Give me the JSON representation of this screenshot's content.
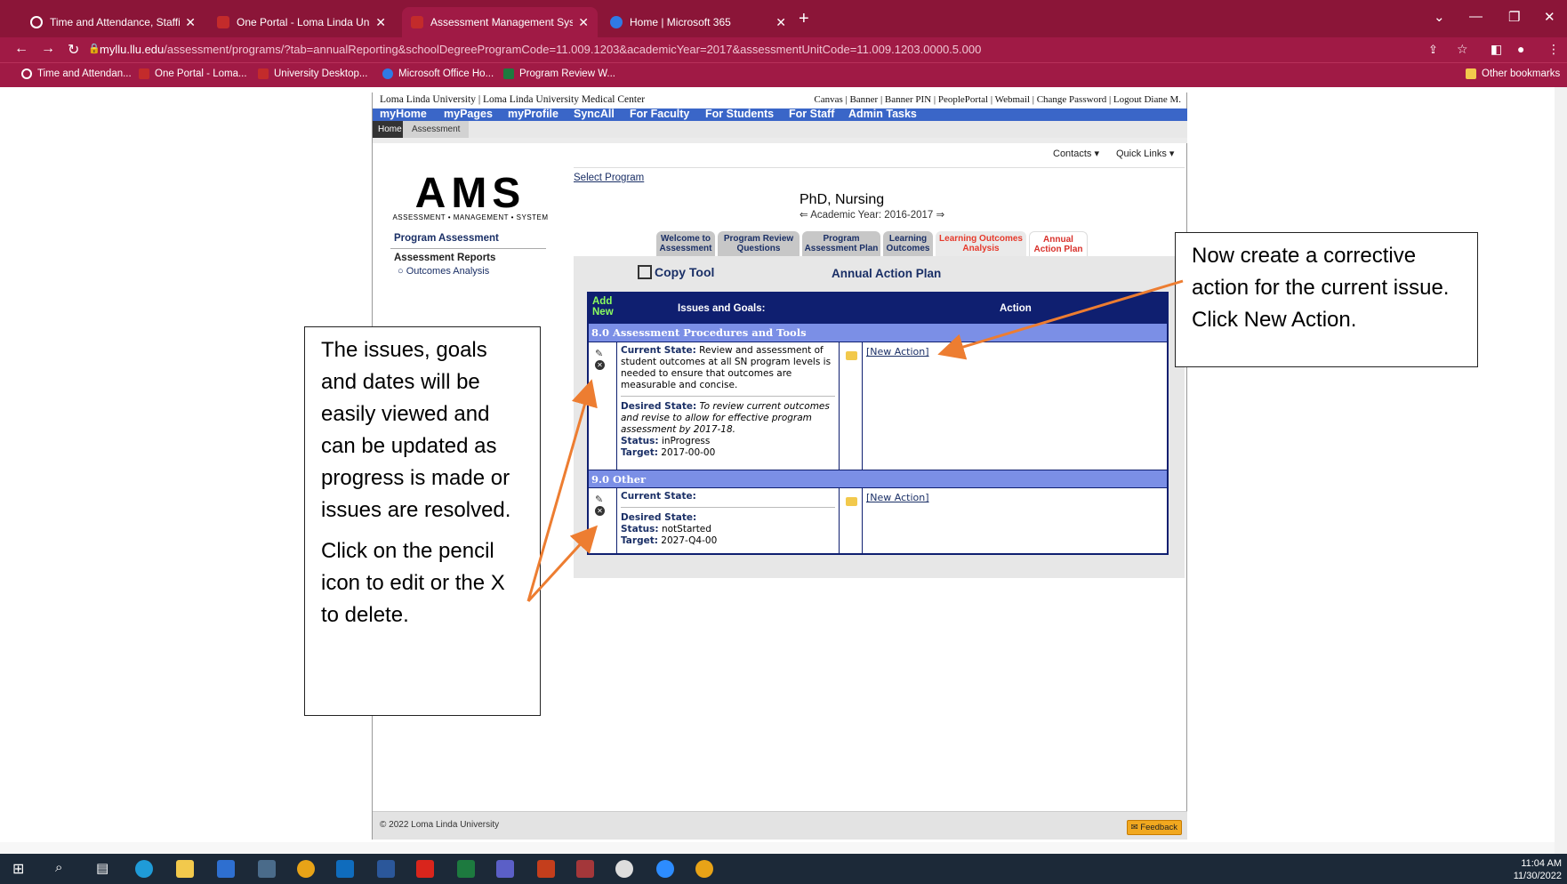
{
  "browser": {
    "tabs": [
      {
        "title": "Time and Attendance, Staffing an",
        "color": "#8b1538"
      },
      {
        "title": "One Portal - Loma Linda Univers",
        "color": "#c32b2b"
      },
      {
        "title": "Assessment Management System",
        "color": "#c32b2b"
      },
      {
        "title": "Home | Microsoft 365",
        "color": "#2f7ae5"
      }
    ],
    "url_host": "myllu.llu.edu",
    "url_path": "/assessment/programs/?tab=annualReporting&schoolDegreeProgramCode=11.009.1203&academicYear=2017&assessmentUnitCode=11.009.1203.0000.5.000",
    "bookmarks": [
      "Time and Attendan...",
      "One Portal - Loma...",
      "University Desktop...",
      "Microsoft Office Ho...",
      "Program Review W..."
    ],
    "other_bookmarks": "Other bookmarks"
  },
  "site": {
    "top_left": "Loma Linda University | Loma Linda University Medical Center",
    "top_right": "Canvas | Banner | Banner PIN | PeoplePortal | Webmail | Change Password | Logout Diane M.",
    "menu": [
      "myHome",
      "myPages",
      "myProfile",
      "SyncAll",
      "For Faculty",
      "For Students",
      "For Staff",
      "Admin Tasks"
    ],
    "breadcrumb": [
      "Home",
      "Assessment"
    ],
    "contacts": "Contacts ▾",
    "quick_links": "Quick Links ▾"
  },
  "ams": {
    "logo": "AMS",
    "logo_sub": "ASSESSMENT • MANAGEMENT • SYSTEM",
    "nav_program_assessment": "Program Assessment",
    "nav_reports": "Assessment Reports",
    "nav_outcomes": "○ Outcomes Analysis",
    "select_program": "Select Program",
    "program_title": "PhD, Nursing",
    "academic_year": "⇐ Academic Year: 2016-2017 ⇒",
    "tabs": [
      {
        "label": "Welcome to Assessment"
      },
      {
        "label": "Program Review Questions"
      },
      {
        "label": "Program Assessment Plan"
      },
      {
        "label": "Learning Outcomes"
      },
      {
        "label": "Learning Outcomes Analysis"
      },
      {
        "label": "Annual Action Plan"
      }
    ],
    "copy_tool": "Copy Tool",
    "annual_action_plan": "Annual Action Plan",
    "grid": {
      "add_new": "Add New",
      "col_issues": "Issues and Goals:",
      "col_action": "Action",
      "sections": [
        {
          "title": "8.0 Assessment Procedures and Tools",
          "current_state_label": "Current State:",
          "current_state": " Review and assessment of student outcomes at all SN program levels is needed to ensure that outcomes are measurable and concise.",
          "desired_state_label": "Desired State:",
          "desired_state": " To review current outcomes and revise to allow for effective program assessment by 2017-18.",
          "status_label": "Status:",
          "status": " inProgress",
          "target_label": "Target:",
          "target": " 2017-00-00",
          "action": "[New Action]"
        },
        {
          "title": "9.0 Other",
          "current_state_label": "Current State:",
          "desired_state_label": "Desired State:",
          "status_label": "Status:",
          "status": " notStarted",
          "target_label": "Target:",
          "target": " 2027-Q4-00",
          "action": "[New Action]"
        }
      ]
    },
    "footer": "© 2022 Loma Linda University",
    "feedback": "✉ Feedback"
  },
  "callouts": {
    "left_para1": "The issues, goals and dates will be easily viewed and can be updated as progress is made or issues are resolved.",
    "left_para2": "Click on the pencil icon to edit or the X to delete.",
    "right": "Now create a corrective action for the current issue. Click New Action."
  },
  "taskbar": {
    "time": "11:04 AM",
    "date": "11/30/2022"
  }
}
